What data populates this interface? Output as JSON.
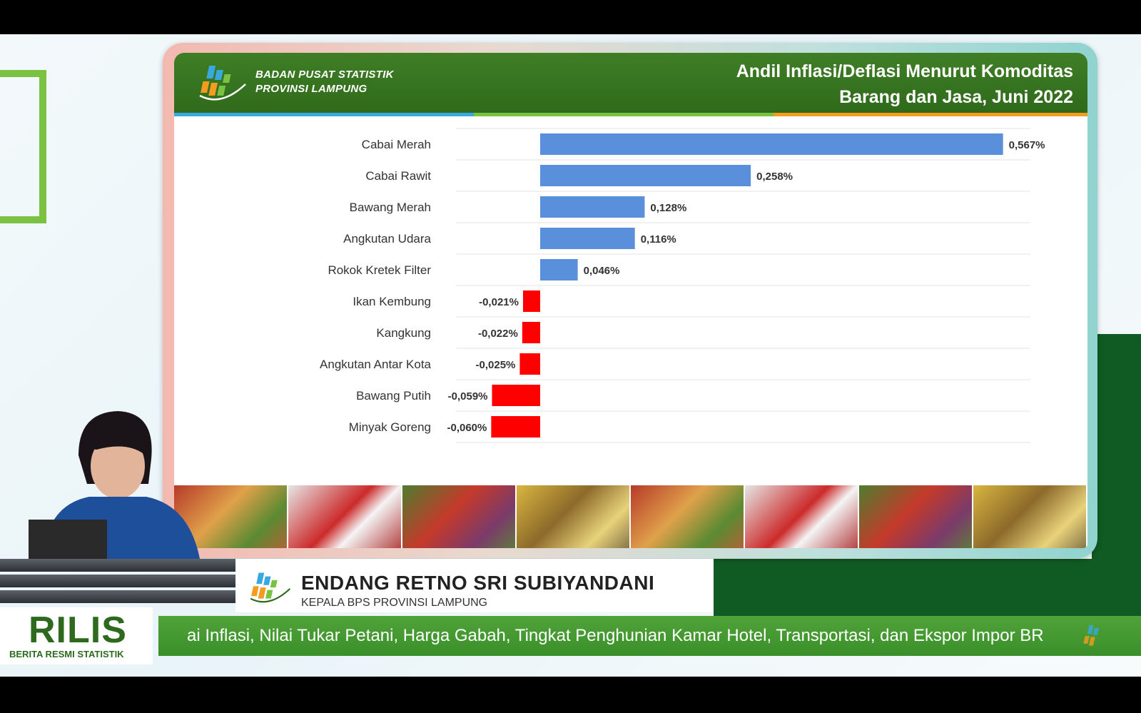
{
  "header": {
    "org_line1": "BADAN PUSAT STATISTIK",
    "org_line2": "PROVINSI LAMPUNG",
    "title_line1": "Andil Inflasi/Deflasi Menurut Komoditas",
    "title_line2": "Barang dan Jasa, Juni 2022"
  },
  "colors": {
    "positive_bar": "#5a8fdb",
    "negative_bar": "#ff0000",
    "header_green": "#2f6a1b",
    "ticker_green": "#45993a"
  },
  "chart_data": {
    "type": "bar",
    "orientation": "horizontal",
    "title": "Andil Inflasi/Deflasi Menurut Komoditas Barang dan Jasa, Juni 2022",
    "categories": [
      "Cabai Merah",
      "Cabai Rawit",
      "Bawang Merah",
      "Angkutan Udara",
      "Rokok Kretek Filter",
      "Ikan Kembung",
      "Kangkung",
      "Angkutan Antar Kota",
      "Bawang Putih",
      "Minyak Goreng"
    ],
    "values": [
      0.567,
      0.258,
      0.128,
      0.116,
      0.046,
      -0.021,
      -0.022,
      -0.025,
      -0.059,
      -0.06
    ],
    "data_labels": [
      "0,567%",
      "0,258%",
      "0,128%",
      "0,116%",
      "0,046%",
      "-0,021%",
      "-0,022%",
      "-0,025%",
      "-0,059%",
      "-0,060%"
    ],
    "xlim": [
      -0.07,
      0.6
    ],
    "grid": true,
    "legend": "none"
  },
  "presenter": {
    "name": "ENDANG RETNO SRI SUBIYANDANI",
    "role": "KEPALA BPS PROVINSI LAMPUNG"
  },
  "branding": {
    "rilis": "RILIS",
    "rilis_sub": "BERITA RESMI STATISTIK"
  },
  "ticker": {
    "text": "ai Inflasi, Nilai Tukar Petani, Harga Gabah, Tingkat Penghunian Kamar Hotel, Transportasi, dan Ekspor Impor  BR"
  }
}
